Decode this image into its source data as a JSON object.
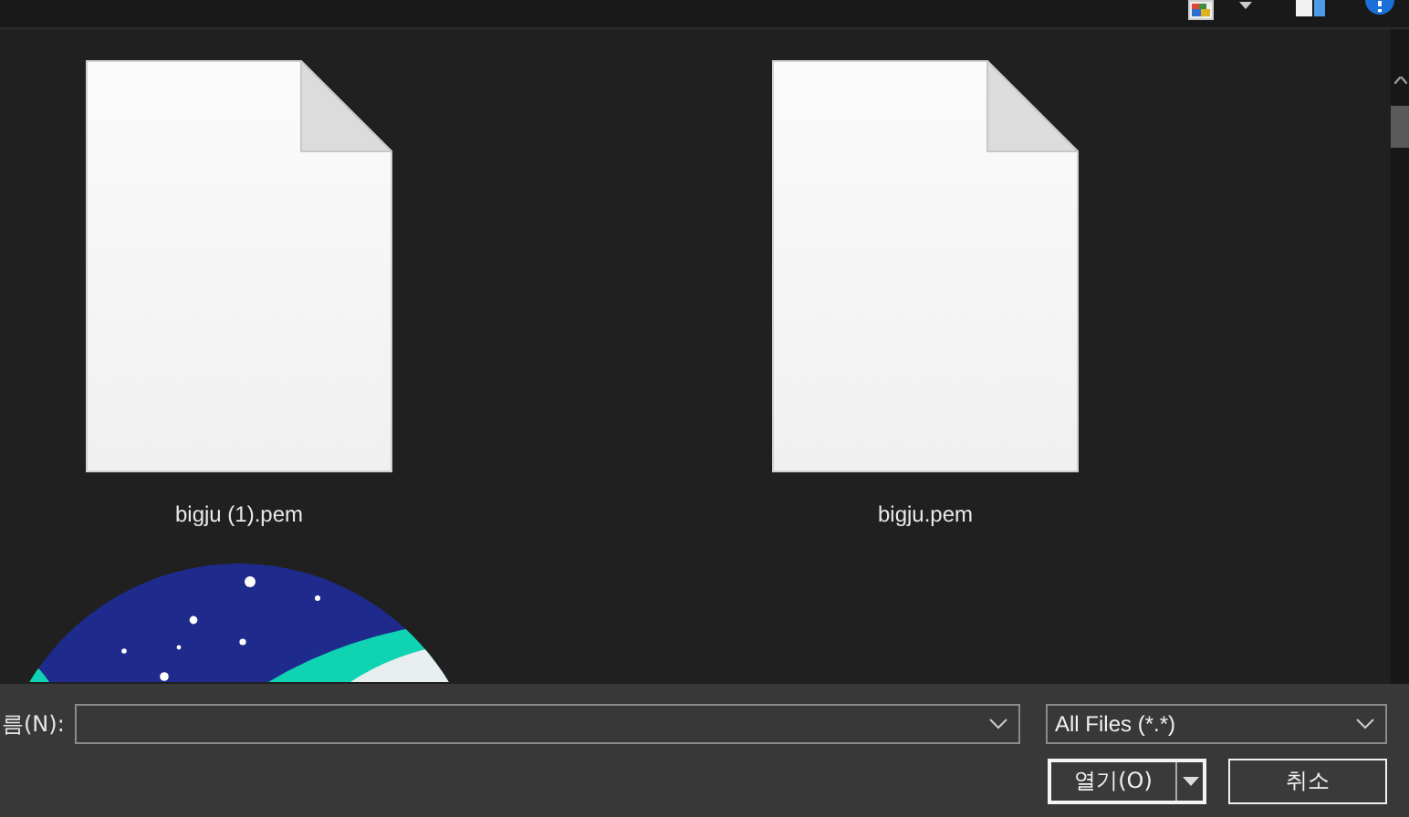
{
  "files": [
    {
      "name": "bigju (1).pem",
      "kind": "document"
    },
    {
      "name": "bigju.pem",
      "kind": "document"
    },
    {
      "kind": "picture"
    }
  ],
  "file_name": {
    "label": "름(N):"
  },
  "filter": {
    "value": "All Files (*.*)"
  },
  "buttons": [
    {
      "label": "열기(O)",
      "kind": "split"
    },
    {
      "label": "취소",
      "kind": "plain"
    }
  ]
}
